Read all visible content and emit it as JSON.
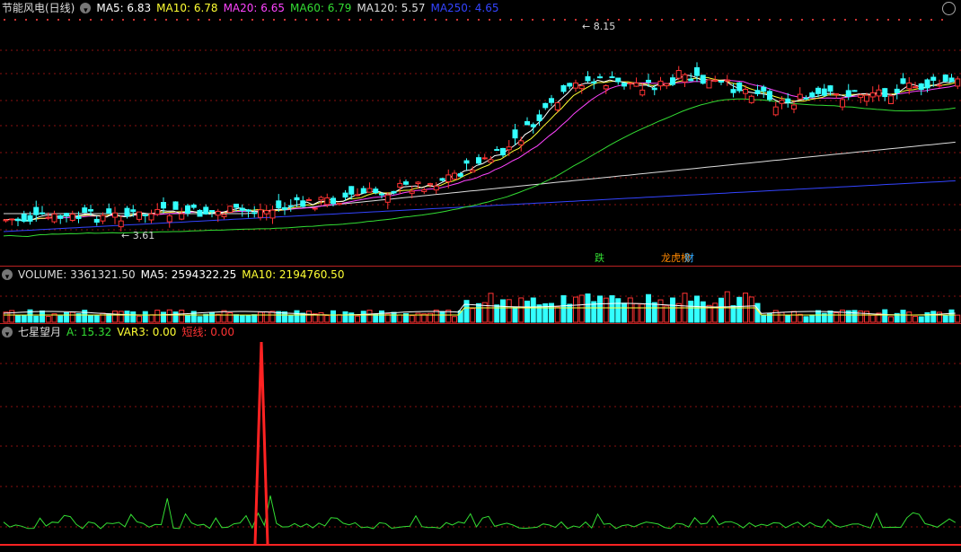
{
  "price_pane": {
    "title": "节能风电(日线)",
    "indicators": [
      {
        "label": "MA5: 6.83",
        "color": "#ffffff"
      },
      {
        "label": "MA10: 6.78",
        "color": "#ffff33"
      },
      {
        "label": "MA20: 6.65",
        "color": "#ff44ff"
      },
      {
        "label": "MA60: 6.79",
        "color": "#33dd33"
      },
      {
        "label": "MA120: 5.57",
        "color": "#dddddd"
      },
      {
        "label": "MA250: 4.65",
        "color": "#3344ff"
      }
    ],
    "high_label": "8.15",
    "low_label": "3.61",
    "badges": [
      {
        "text": "跌",
        "color": "#33dd33"
      },
      {
        "text": "龙虎榜",
        "color": "#ff8800"
      },
      {
        "text": "财",
        "color": "#33aaff"
      }
    ]
  },
  "volume_pane": {
    "title": "VOLUME: 3361321.50",
    "ma5": "MA5: 2594322.25",
    "ma10": "MA10: 2194760.50"
  },
  "indicator_pane": {
    "title": "七星望月",
    "a": "A: 15.32",
    "var3": "VAR3: 0.00",
    "short": "短线: 0.00"
  },
  "colors": {
    "up": "#ff3333",
    "down": "#33ffff",
    "grid": "#8a1010"
  },
  "icons": {
    "collapse": "collapse-circle-icon",
    "corner": "circle-icon"
  }
}
